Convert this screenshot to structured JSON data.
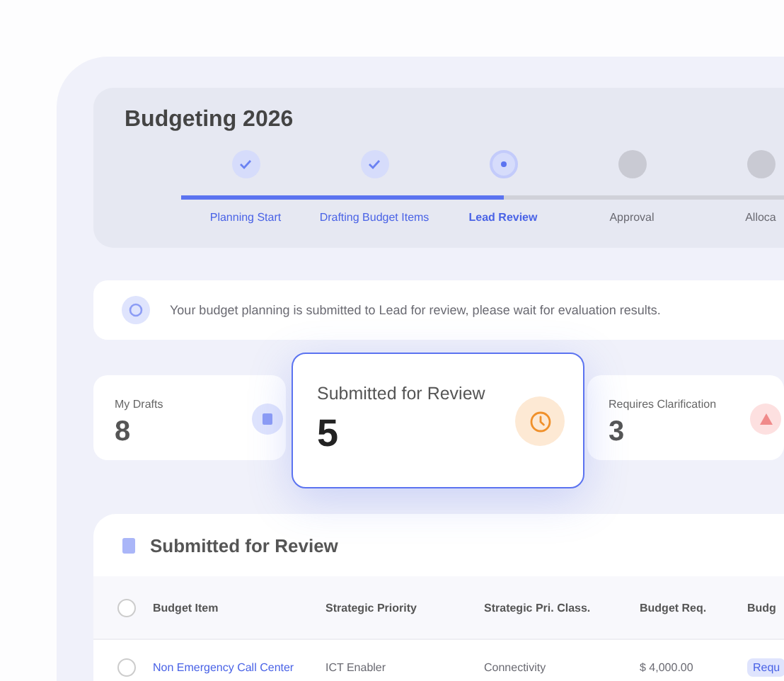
{
  "title": "Budgeting 2026",
  "steps": [
    {
      "label": "Planning Start",
      "completed": true,
      "selected": false
    },
    {
      "label": "Drafting Budget Items",
      "completed": true,
      "selected": false
    },
    {
      "label": "Lead Review",
      "completed": false,
      "selected": true
    },
    {
      "label": "Approval",
      "completed": false,
      "selected": false
    },
    {
      "label": "Alloca",
      "completed": false,
      "selected": false
    }
  ],
  "alert": {
    "message": "Your budget planning is submitted to Lead for review, please wait for evaluation results."
  },
  "stats": [
    {
      "label": "My Drafts",
      "value": "8",
      "kind": "drafts",
      "focused": false
    },
    {
      "label": "Submitted for Review",
      "value": "5",
      "kind": "review",
      "focused": true
    },
    {
      "label": "Requires Clarification",
      "value": "3",
      "kind": "clarify",
      "focused": false
    }
  ],
  "table": {
    "title": "Submitted for Review",
    "all_checked": false,
    "columns": [
      "Budget Item",
      "Strategic Priority",
      "Strategic Pri. Class.",
      "Budget Req.",
      "Budg"
    ],
    "rows": [
      {
        "checked": false,
        "cells": [
          "Non Emergency Call Center",
          "ICT Enabler",
          "Connectivity",
          "$ 4,000.00",
          "Requ"
        ]
      }
    ]
  }
}
